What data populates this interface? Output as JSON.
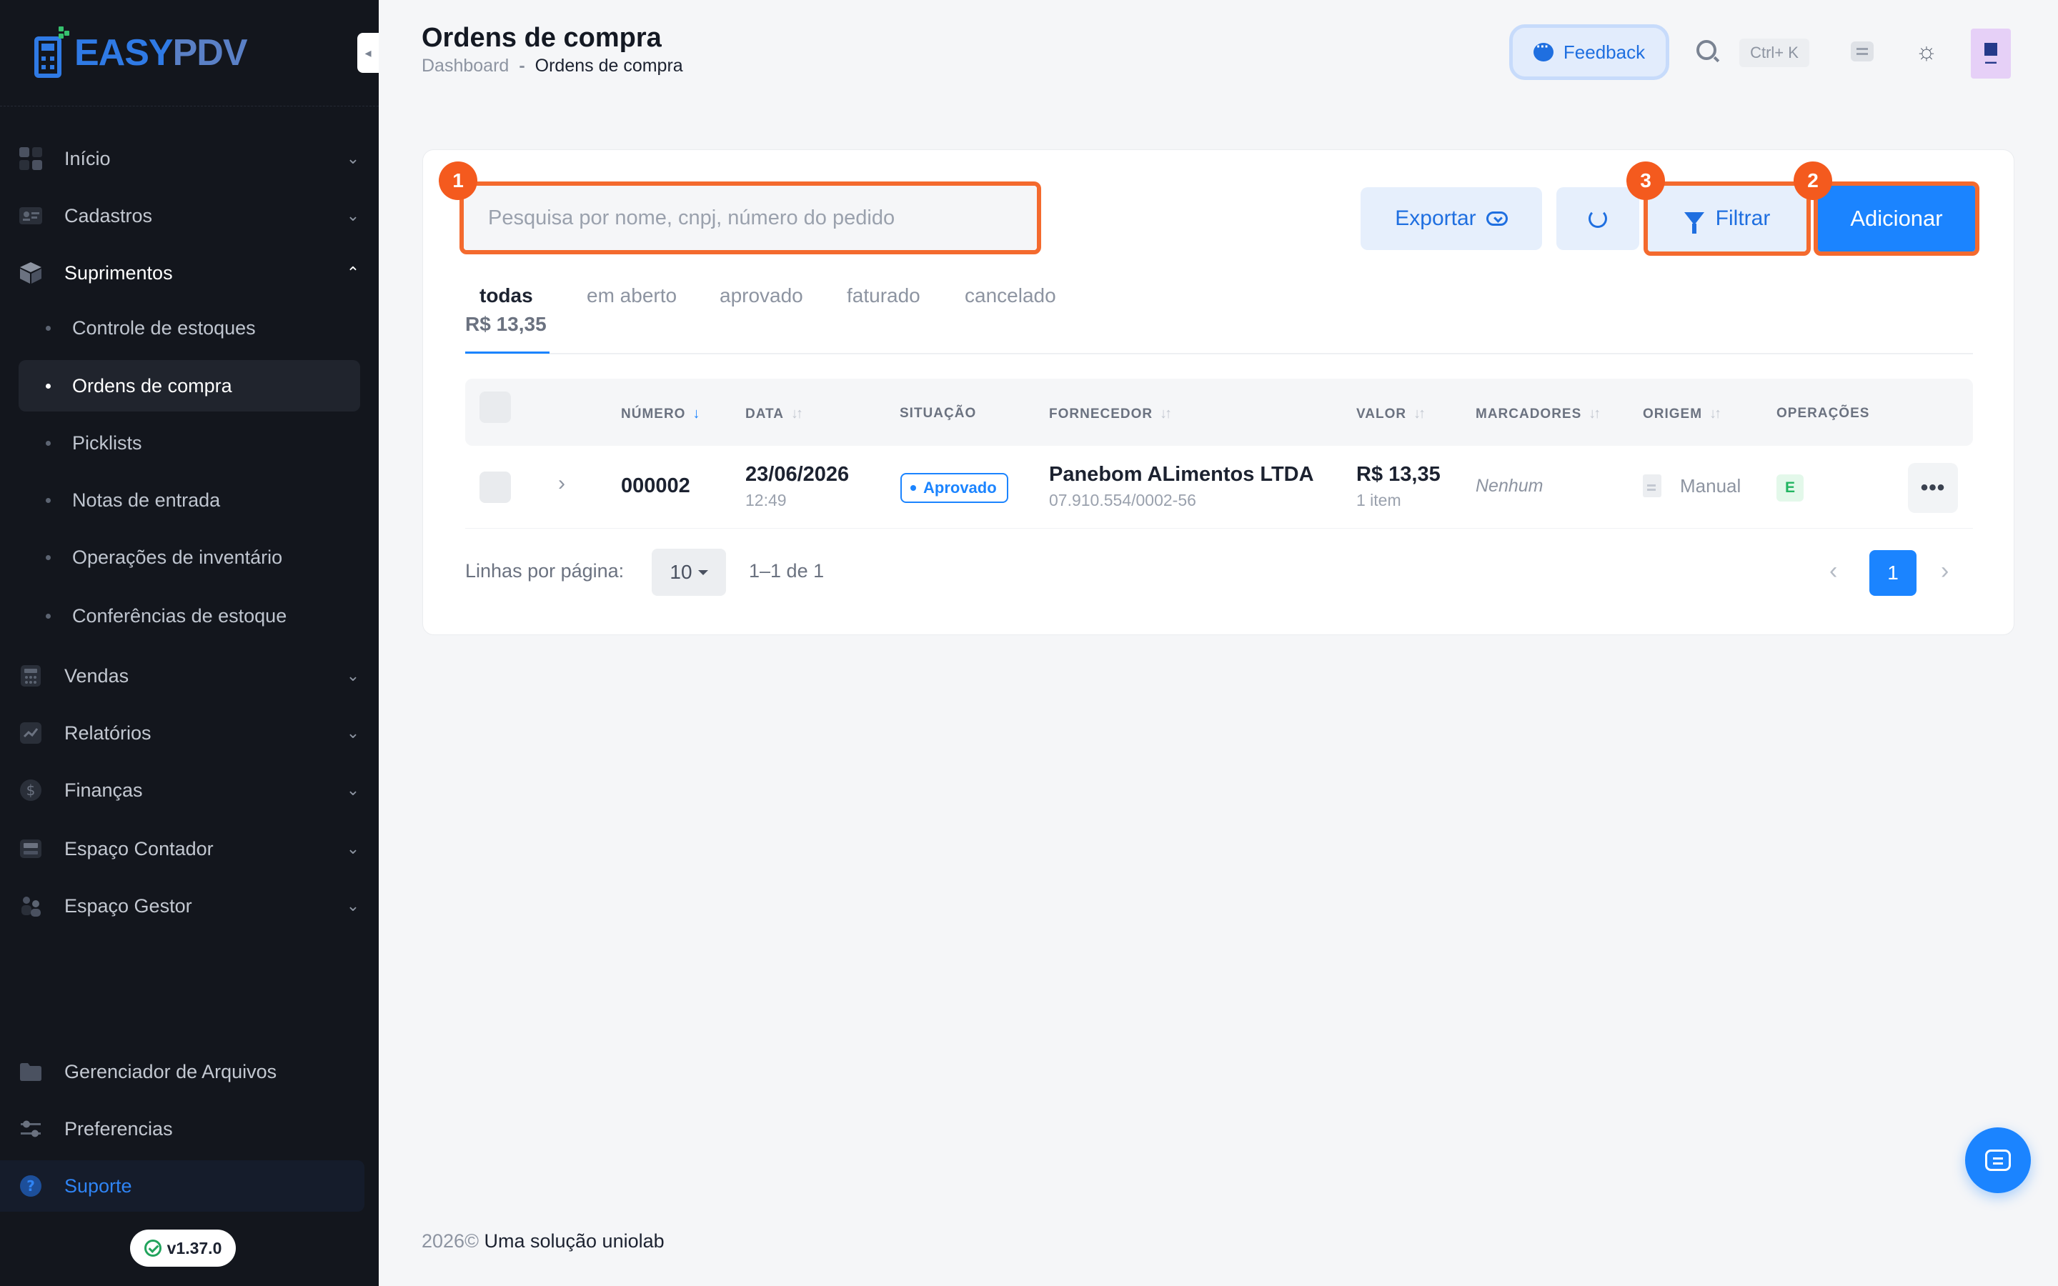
{
  "sidebar": {
    "logo": {
      "part1": "EASY",
      "part2": "PDV"
    },
    "items": [
      {
        "label": "Início",
        "icon": "grid-icon"
      },
      {
        "label": "Cadastros",
        "icon": "id-card-icon"
      },
      {
        "label": "Suprimentos",
        "icon": "box-icon"
      },
      {
        "label": "Vendas",
        "icon": "calculator-icon"
      },
      {
        "label": "Relatórios",
        "icon": "chart-icon"
      },
      {
        "label": "Finanças",
        "icon": "dollar-icon"
      },
      {
        "label": "Espaço Contador",
        "icon": "register-icon"
      },
      {
        "label": "Espaço Gestor",
        "icon": "people-icon"
      }
    ],
    "sub_items": [
      {
        "label": "Controle de estoques"
      },
      {
        "label": "Ordens de compra"
      },
      {
        "label": "Picklists"
      },
      {
        "label": "Notas de entrada"
      },
      {
        "label": "Operações de inventário"
      },
      {
        "label": "Conferências de estoque"
      }
    ],
    "bottom": [
      {
        "label": "Gerenciador de Arquivos",
        "icon": "folder-icon"
      },
      {
        "label": "Preferencias",
        "icon": "sliders-icon"
      },
      {
        "label": "Suporte",
        "icon": "question-icon"
      }
    ],
    "version": "v1.37.0"
  },
  "header": {
    "title": "Ordens de compra",
    "breadcrumb": [
      "Dashboard",
      "-",
      "Ordens de compra"
    ],
    "feedback_label": "Feedback",
    "shortcut": "Ctrl+ K"
  },
  "toolbar": {
    "search_placeholder": "Pesquisa por nome, cnpj, número do pedido",
    "export_label": "Exportar",
    "filter_label": "Filtrar",
    "add_label": "Adicionar",
    "markers": [
      "1",
      "2",
      "3"
    ]
  },
  "tabs": [
    {
      "label": "todas",
      "amount": "R$ 13,35"
    },
    {
      "label": "em aberto"
    },
    {
      "label": "aprovado"
    },
    {
      "label": "faturado"
    },
    {
      "label": "cancelado"
    }
  ],
  "table": {
    "columns": [
      "NÚMERO",
      "DATA",
      "SITUAÇÃO",
      "FORNECEDOR",
      "VALOR",
      "MARCADORES",
      "ORIGEM",
      "OPERAÇÕES"
    ],
    "rows": [
      {
        "numero": "000002",
        "data": "23/06/2026",
        "hora": "12:49",
        "situacao": "Aprovado",
        "fornecedor": "Panebom ALimentos LTDA",
        "cnpj": "07.910.554/0002-56",
        "valor": "R$ 13,35",
        "itens": "1 item",
        "marcadores": "Nenhum",
        "origem": "Manual",
        "operacao": "E"
      }
    ]
  },
  "pagination": {
    "rows_label": "Linhas por página:",
    "rows_value": "10",
    "range": "1–1 de 1",
    "current": "1"
  },
  "footer": {
    "year": "2026©",
    "text": "Uma solução uniolab"
  },
  "colors": {
    "accent": "#1b84ff",
    "highlight": "#f46a2e",
    "sidebar": "#13161d"
  }
}
